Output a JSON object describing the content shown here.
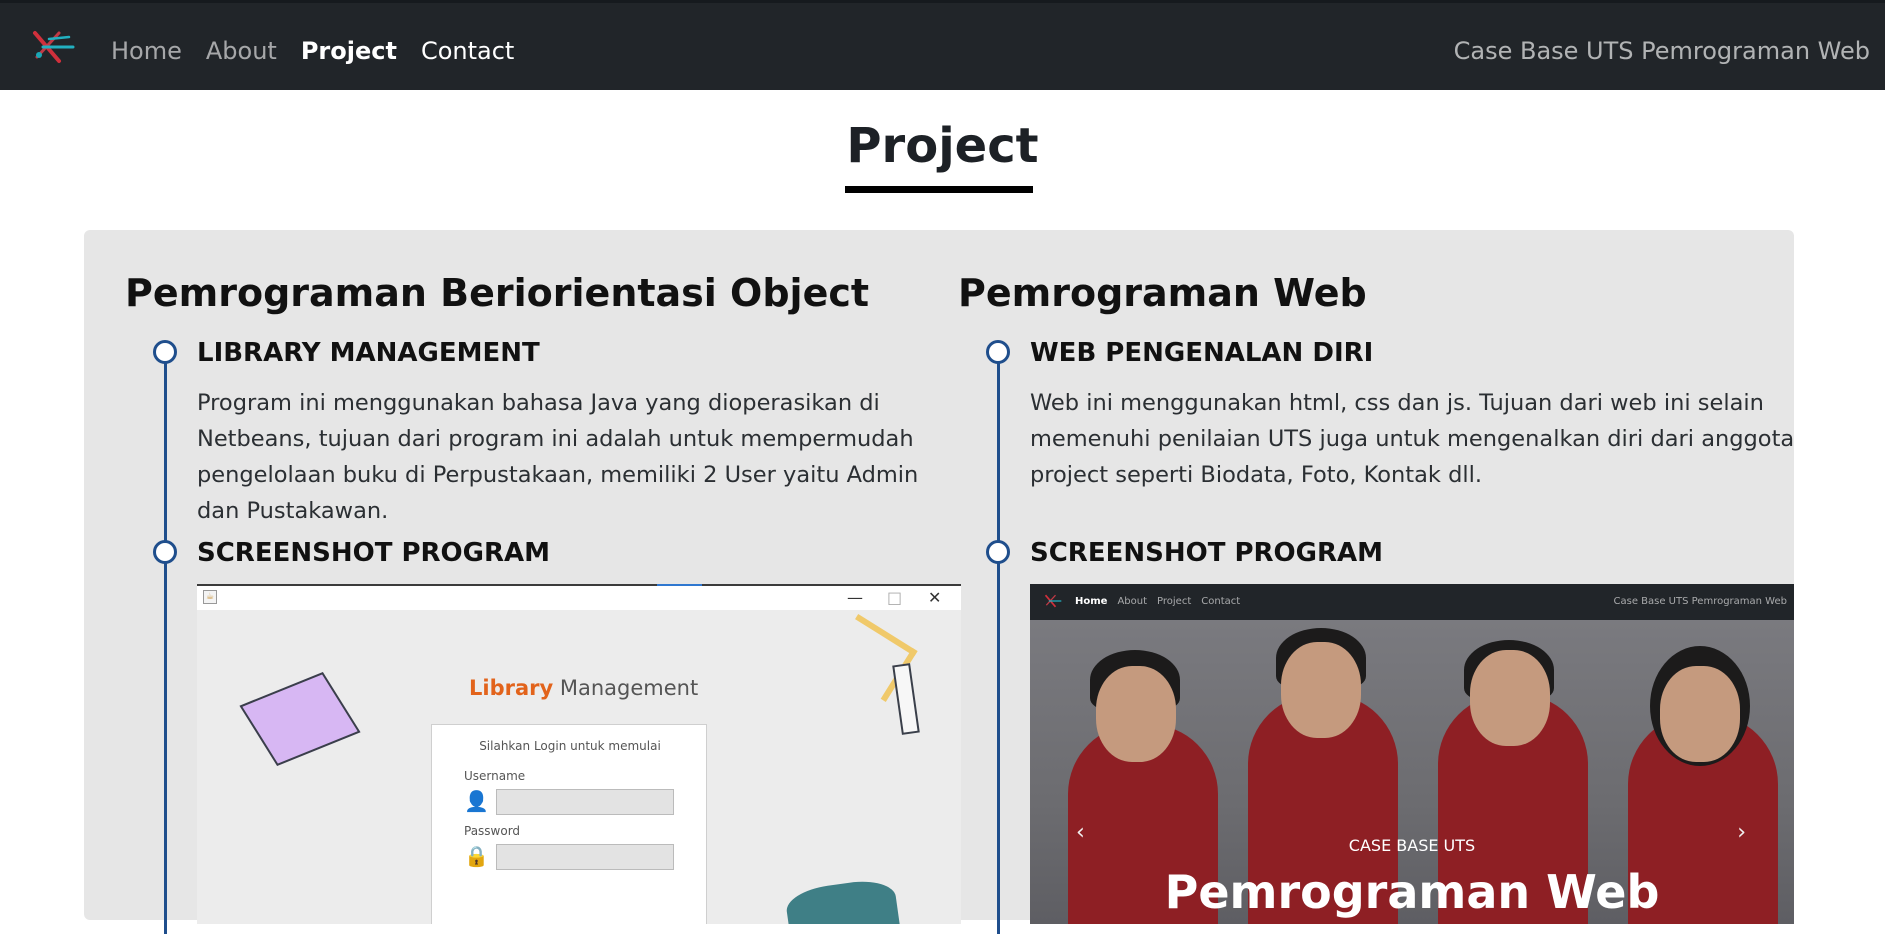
{
  "navbar": {
    "logo": "brand-logo",
    "links": [
      "Home",
      "About",
      "Project",
      "Contact"
    ],
    "active": "Project",
    "right_text": "Case Base UTS Pemrograman Web"
  },
  "page": {
    "title": "Project"
  },
  "columns": [
    {
      "title": "Pemrograman Beriorientasi Object",
      "items": [
        {
          "heading": "LIBRARY MANAGEMENT",
          "description": "Program ini menggunakan bahasa Java yang dioperasikan di Netbeans, tujuan dari program ini adalah untuk mempermudah pengelolaan buku di Perpustakaan, memiliki 2 User yaitu Admin dan Pustakawan."
        },
        {
          "heading": "SCREENSHOT PROGRAM"
        }
      ],
      "screenshot": {
        "app_title_accent": "Library",
        "app_title_rest": "Management",
        "login_prompt": "Silahkan Login untuk memulai",
        "username_label": "Username",
        "password_label": "Password",
        "window_controls": [
          "—",
          "□",
          "✕"
        ]
      }
    },
    {
      "title": "Pemrograman Web",
      "items": [
        {
          "heading": "WEB PENGENALAN DIRI",
          "description": "Web ini menggunakan html, css dan js. Tujuan dari web ini selain memenuhi penilaian UTS juga untuk mengenalkan diri dari anggota project seperti Biodata, Foto, Kontak dll."
        },
        {
          "heading": "SCREENSHOT PROGRAM"
        }
      ],
      "screenshot": {
        "nav_links": [
          "Home",
          "About",
          "Project",
          "Contact"
        ],
        "nav_active": "Home",
        "nav_right": "Case Base UTS Pemrograman Web",
        "hero_small": "CASE BASE UTS",
        "hero_big": "Pemrograman Web",
        "arrow_left": "‹",
        "arrow_right": "›"
      }
    }
  ],
  "colors": {
    "navbar_bg": "#212529",
    "panel_bg": "#e6e6e6",
    "timeline": "#1f4e8c",
    "library_accent": "#e2631b"
  }
}
